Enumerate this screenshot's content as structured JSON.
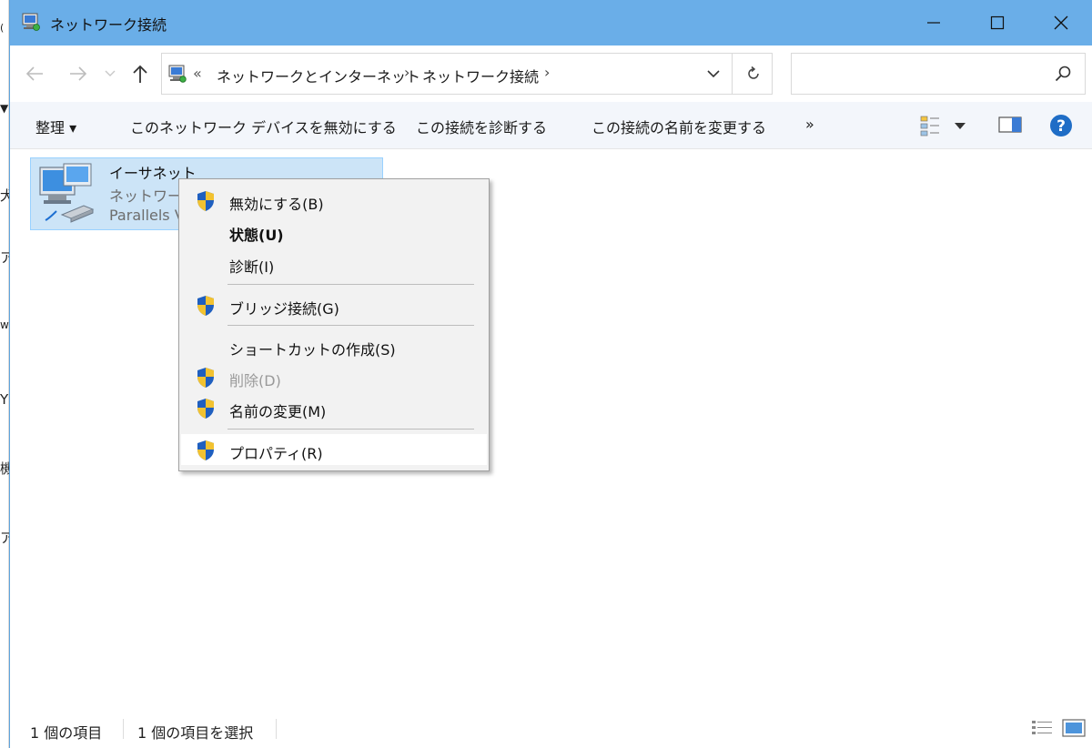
{
  "window": {
    "title": "ネットワーク接続",
    "accent": "#6aaee8"
  },
  "address": {
    "overflow": "«",
    "crumbs": [
      "ネットワークとインターネット",
      "ネットワーク接続"
    ],
    "separator": "›",
    "search_placeholder": ""
  },
  "commands": {
    "organize": "整理 ▾",
    "disable_device": "このネットワーク デバイスを無効にする",
    "diagnose": "この接続を診断する",
    "rename": "この接続の名前を変更する",
    "more": "»"
  },
  "item": {
    "name": "イーサネット",
    "status_partial": "ネットワーク",
    "adapter_partial": "Parallels V"
  },
  "context_menu": {
    "items": [
      {
        "label": "無効にする(B)",
        "icon": "uac-shield-icon"
      },
      {
        "label": "状態(U)",
        "bold": true
      },
      {
        "label": "診断(I)"
      },
      {
        "label": "ブリッジ接続(G)",
        "icon": "uac-shield-icon"
      },
      {
        "label": "ショートカットの作成(S)"
      },
      {
        "label": "削除(D)",
        "icon": "uac-shield-icon",
        "disabled": true
      },
      {
        "label": "名前の変更(M)",
        "icon": "uac-shield-icon"
      },
      {
        "label": "プロパティ(R)",
        "icon": "uac-shield-icon",
        "highlighted": true
      }
    ]
  },
  "status": {
    "count": "1 個の項目",
    "selected": "1 個の項目を選択"
  },
  "background_window_chars": [
    "(",
    "▼",
    "犬",
    "ア",
    "w.",
    "YF",
    "機",
    "ア"
  ]
}
